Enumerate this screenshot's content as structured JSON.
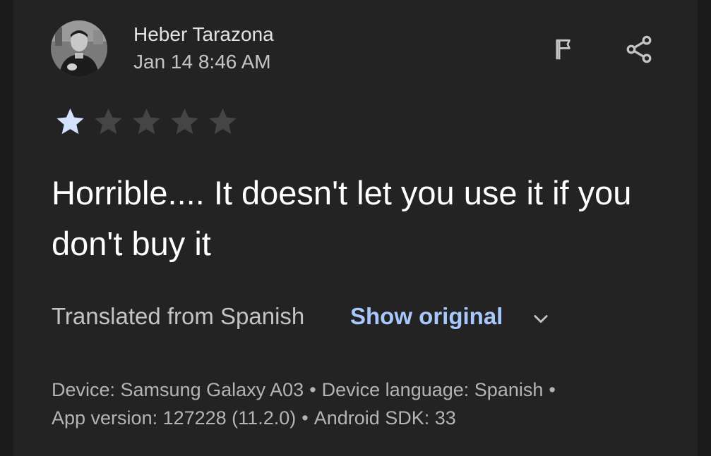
{
  "review": {
    "author_name": "Heber Tarazona",
    "date": "Jan 14 8:46 AM",
    "rating": 1,
    "max_rating": 5,
    "text": "Horrible.... It doesn't let you use it if you don't buy it",
    "translation": {
      "label": "Translated from Spanish",
      "toggle_label": "Show original"
    },
    "meta": {
      "device": "Device: Samsung Galaxy A03",
      "device_language": "Device language: Spanish",
      "app_version": "App version: 127228 (11.2.0)",
      "android_sdk": "Android SDK: 33",
      "separator": "•"
    }
  },
  "icons": {
    "flag": "flag-icon",
    "share": "share-icon",
    "expand": "chevron-down-icon",
    "star": "star-icon"
  },
  "colors": {
    "background": "#232323",
    "star_filled": "#d3e3fd",
    "star_empty": "#454545",
    "link": "#a8c7fa",
    "primary_text": "#ffffff",
    "secondary_text": "#c4c4c4"
  }
}
